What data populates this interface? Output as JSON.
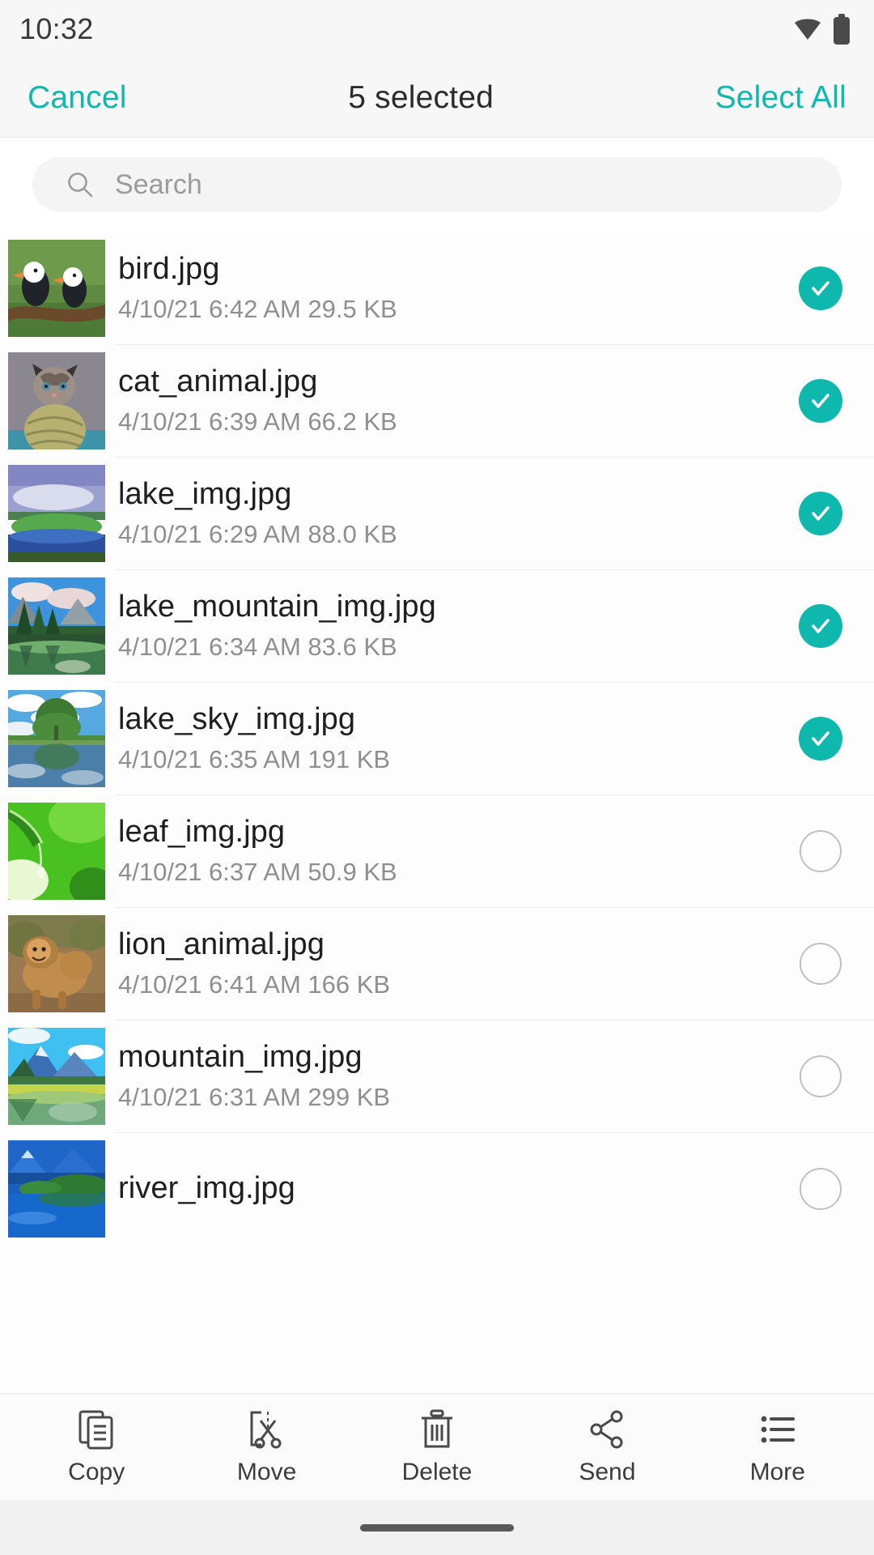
{
  "status_bar": {
    "time": "10:32",
    "wifi_icon": "wifi-icon",
    "battery_icon": "battery-full-icon"
  },
  "action_bar": {
    "cancel_label": "Cancel",
    "title": "5 selected",
    "select_all_label": "Select All",
    "accent_color": "#0fb8ac"
  },
  "search": {
    "placeholder": "Search",
    "value": "",
    "icon": "search-icon"
  },
  "file_list": {
    "items": [
      {
        "name": "bird.jpg",
        "meta": "4/10/21 6:42 AM 29.5 KB",
        "date": "4/10/21",
        "time": "6:42 AM",
        "size": "29.5 KB",
        "selected": true,
        "thumb": "birds-on-branch"
      },
      {
        "name": "cat_animal.jpg",
        "meta": "4/10/21 6:39 AM 66.2 KB",
        "date": "4/10/21",
        "time": "6:39 AM",
        "size": "66.2 KB",
        "selected": true,
        "thumb": "kitten-with-yarn"
      },
      {
        "name": "lake_img.jpg",
        "meta": "4/10/21 6:29 AM 88.0 KB",
        "date": "4/10/21",
        "time": "6:29 AM",
        "size": "88.0 KB",
        "selected": true,
        "thumb": "lake-green-island"
      },
      {
        "name": "lake_mountain_img.jpg",
        "meta": "4/10/21 6:34 AM 83.6 KB",
        "date": "4/10/21",
        "time": "6:34 AM",
        "size": "83.6 KB",
        "selected": true,
        "thumb": "lake-with-pines"
      },
      {
        "name": "lake_sky_img.jpg",
        "meta": "4/10/21 6:35 AM 191 KB",
        "date": "4/10/21",
        "time": "6:35 AM",
        "size": "191 KB",
        "selected": true,
        "thumb": "tree-reflection-lake"
      },
      {
        "name": "leaf_img.jpg",
        "meta": "4/10/21 6:37 AM 50.9 KB",
        "date": "4/10/21",
        "time": "6:37 AM",
        "size": "50.9 KB",
        "selected": false,
        "thumb": "green-leaf-droplet"
      },
      {
        "name": "lion_animal.jpg",
        "meta": "4/10/21 6:41 AM 166 KB",
        "date": "4/10/21",
        "time": "6:41 AM",
        "size": "166 KB",
        "selected": false,
        "thumb": "lions-savanna"
      },
      {
        "name": "mountain_img.jpg",
        "meta": "4/10/21 6:31 AM 299 KB",
        "date": "4/10/21",
        "time": "6:31 AM",
        "size": "299 KB",
        "selected": false,
        "thumb": "mountain-lake"
      },
      {
        "name": "river_img.jpg",
        "meta": "",
        "date": "",
        "time": "",
        "size": "",
        "selected": false,
        "thumb": "river-blue-mountains"
      }
    ],
    "selected_count": 5,
    "checked_color": "#0fb8ac",
    "unchecked_border_color": "#c0c0c0"
  },
  "toolbar": {
    "items": [
      {
        "label": "Copy",
        "icon": "copy-icon"
      },
      {
        "label": "Move",
        "icon": "cut-scissors-icon"
      },
      {
        "label": "Delete",
        "icon": "trash-icon"
      },
      {
        "label": "Send",
        "icon": "share-icon"
      },
      {
        "label": "More",
        "icon": "list-more-icon"
      }
    ]
  },
  "navigation_bar": {
    "home_indicator": "home-pill"
  }
}
